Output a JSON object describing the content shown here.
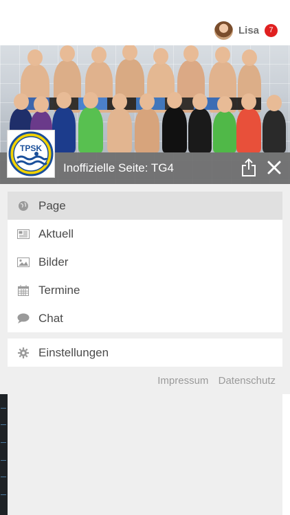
{
  "user": {
    "name": "Lisa",
    "notifications": "7"
  },
  "header": {
    "title": "Inoffizielle Seite: TG4",
    "logo_text": "TPSK"
  },
  "menu": {
    "items": [
      {
        "label": "Page",
        "icon": "globe-icon",
        "active": true
      },
      {
        "label": "Aktuell",
        "icon": "newspaper-icon"
      },
      {
        "label": "Bilder",
        "icon": "image-icon"
      },
      {
        "label": "Termine",
        "icon": "calendar-icon"
      },
      {
        "label": "Chat",
        "icon": "chat-bubble-icon"
      }
    ],
    "settings": {
      "label": "Einstellungen",
      "icon": "gear-icon"
    }
  },
  "footer": {
    "impressum": "Impressum",
    "datenschutz": "Datenschutz"
  },
  "colors": {
    "badge": "#e02020",
    "caption_bar": "#6e6e6e",
    "menu_active": "#e0e0e0",
    "background": "#efefef"
  }
}
